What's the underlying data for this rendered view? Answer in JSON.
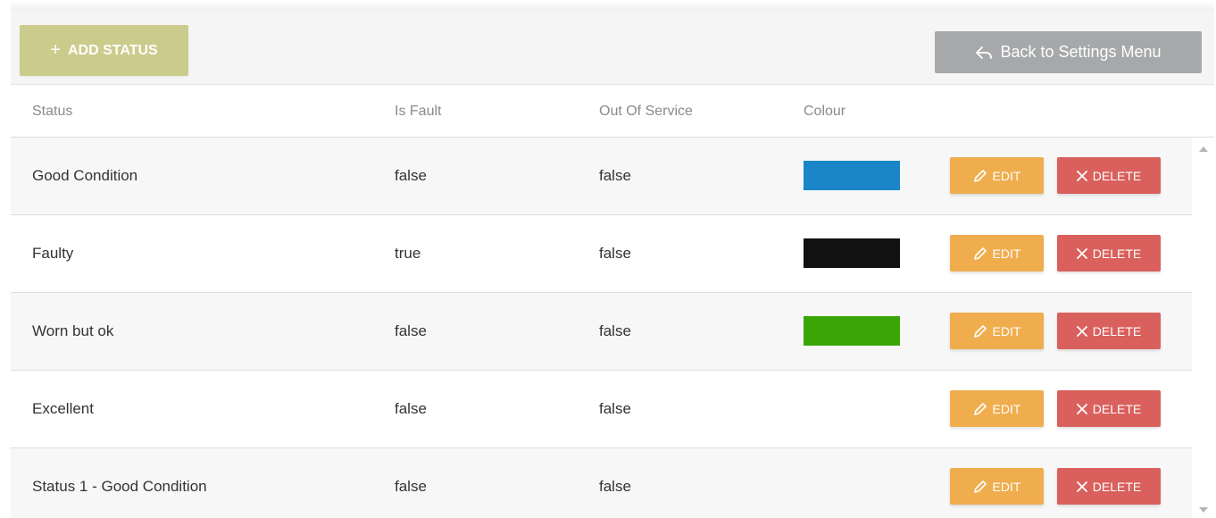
{
  "toolbar": {
    "add_label": "ADD STATUS",
    "add_icon": "+",
    "back_label": "Back to Settings Menu"
  },
  "table": {
    "columns": [
      "Status",
      "Is Fault",
      "Out Of Service",
      "Colour"
    ],
    "rows": [
      {
        "status": "Good Condition",
        "is_fault": "false",
        "out_of_service": "false",
        "colour": "#1a86c8"
      },
      {
        "status": "Faulty",
        "is_fault": "true",
        "out_of_service": "false",
        "colour": "#111111"
      },
      {
        "status": "Worn but ok",
        "is_fault": "false",
        "out_of_service": "false",
        "colour": "#3aa606"
      },
      {
        "status": "Excellent",
        "is_fault": "false",
        "out_of_service": "false",
        "colour": ""
      },
      {
        "status": "Status 1 - Good Condition",
        "is_fault": "false",
        "out_of_service": "false",
        "colour": ""
      }
    ],
    "edit_label": "EDIT",
    "delete_label": "DELETE"
  },
  "colors": {
    "add_button": "#cbcc8c",
    "back_button": "#a6a8aa",
    "edit_button": "#f0ad4e",
    "delete_button": "#d9605c"
  },
  "icons": {
    "add": "plus-icon",
    "back": "reply-arrow-icon",
    "edit": "pencil-icon",
    "delete": "close-icon",
    "scroll_up": "scroll-up-arrow-icon",
    "scroll_down": "scroll-down-arrow-icon"
  }
}
